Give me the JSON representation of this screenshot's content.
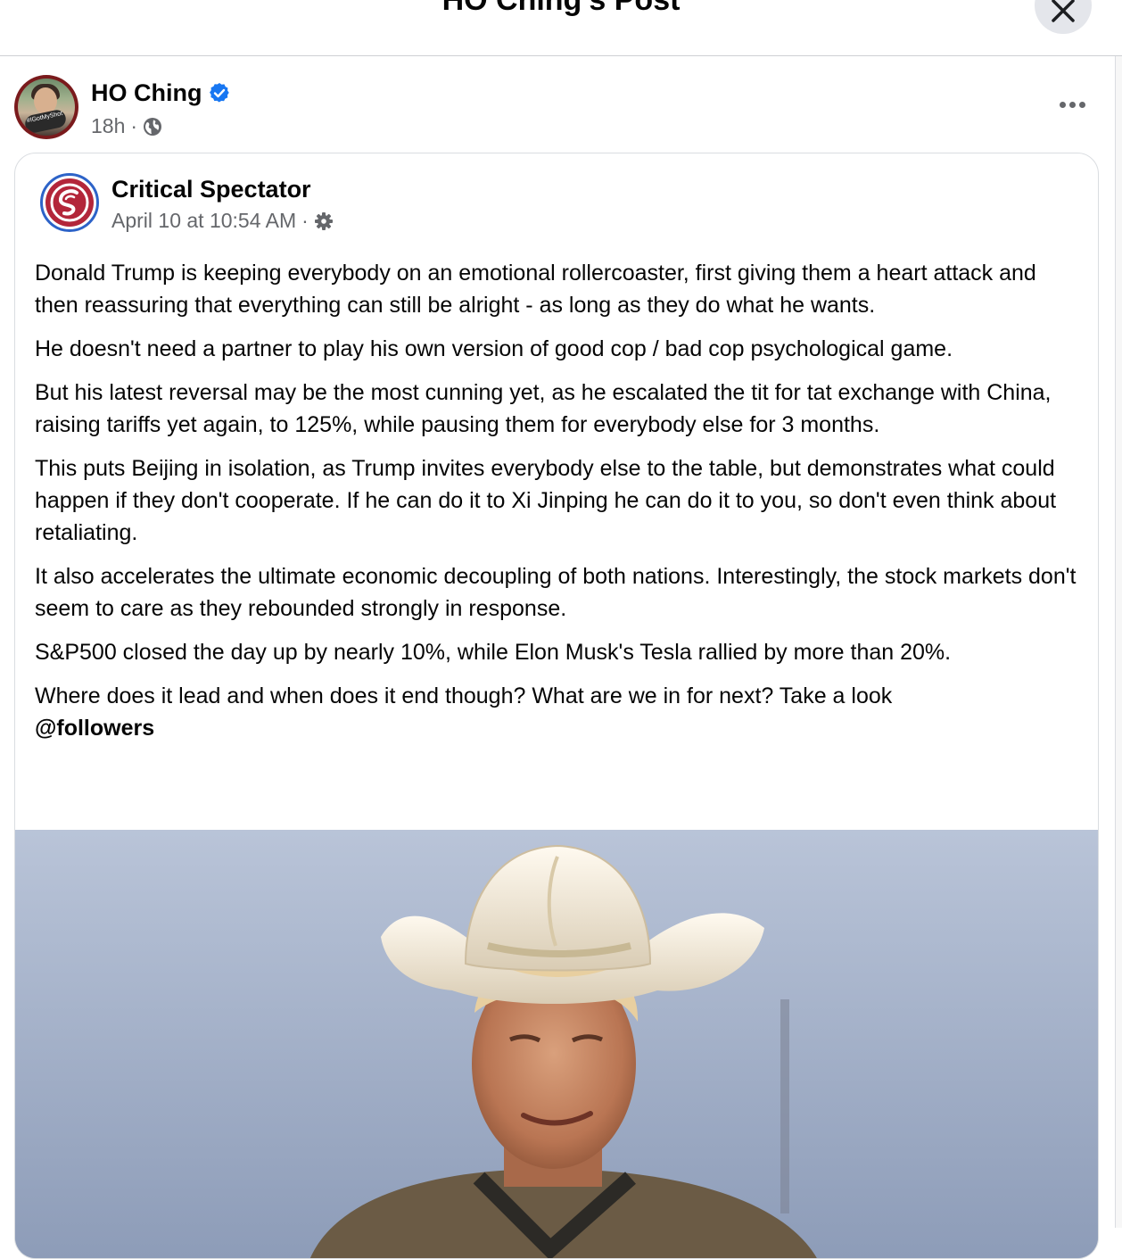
{
  "dialog": {
    "title": "HO Ching's Post"
  },
  "author": {
    "name": "HO Ching",
    "verified": true,
    "time": "18h",
    "separator": "·",
    "avatar_badge": "#IGotMyShot"
  },
  "shared_post": {
    "page_name": "Critical Spectator",
    "timestamp": "April 10 at 10:54 AM",
    "separator": "·",
    "paragraphs": [
      "Donald Trump is keeping everybody on an emotional rollercoaster, first giving them a heart attack and then reassuring that everything can still be alright - as long as they do what he wants.",
      "He doesn't need a partner to play his own version of good cop / bad cop psychological game.",
      "But his latest reversal may be the most cunning yet, as he escalated the tit for tat exchange with China, raising tariffs yet again, to 125%, while pausing them for everybody else for 3 months.",
      "This puts Beijing in isolation, as Trump invites everybody else to the table, but demonstrates what could happen if they don't cooperate. If he can do it to Xi Jinping he can do it to you, so don't even think about retaliating.",
      "It also accelerates the ultimate economic decoupling of both nations. Interestingly, the stock markets don't seem to care as they rebounded strongly in response.",
      "S&P500 closed the day up by nearly 10%, while Elon Musk's Tesla rallied by more than 20%."
    ],
    "last_paragraph": "Where does it lead and when does it end though? What are we in for next? Take a look",
    "mention": "@followers"
  },
  "icons": {
    "close": "close-icon",
    "verified": "verified-badge-icon",
    "globe": "globe-icon",
    "gear": "gear-icon",
    "more": "more-options-icon"
  },
  "colors": {
    "verified_blue": "#1877f2",
    "secondary_text": "#65676b",
    "logo_red": "#b3263a",
    "logo_ring": "#2d63c8"
  }
}
